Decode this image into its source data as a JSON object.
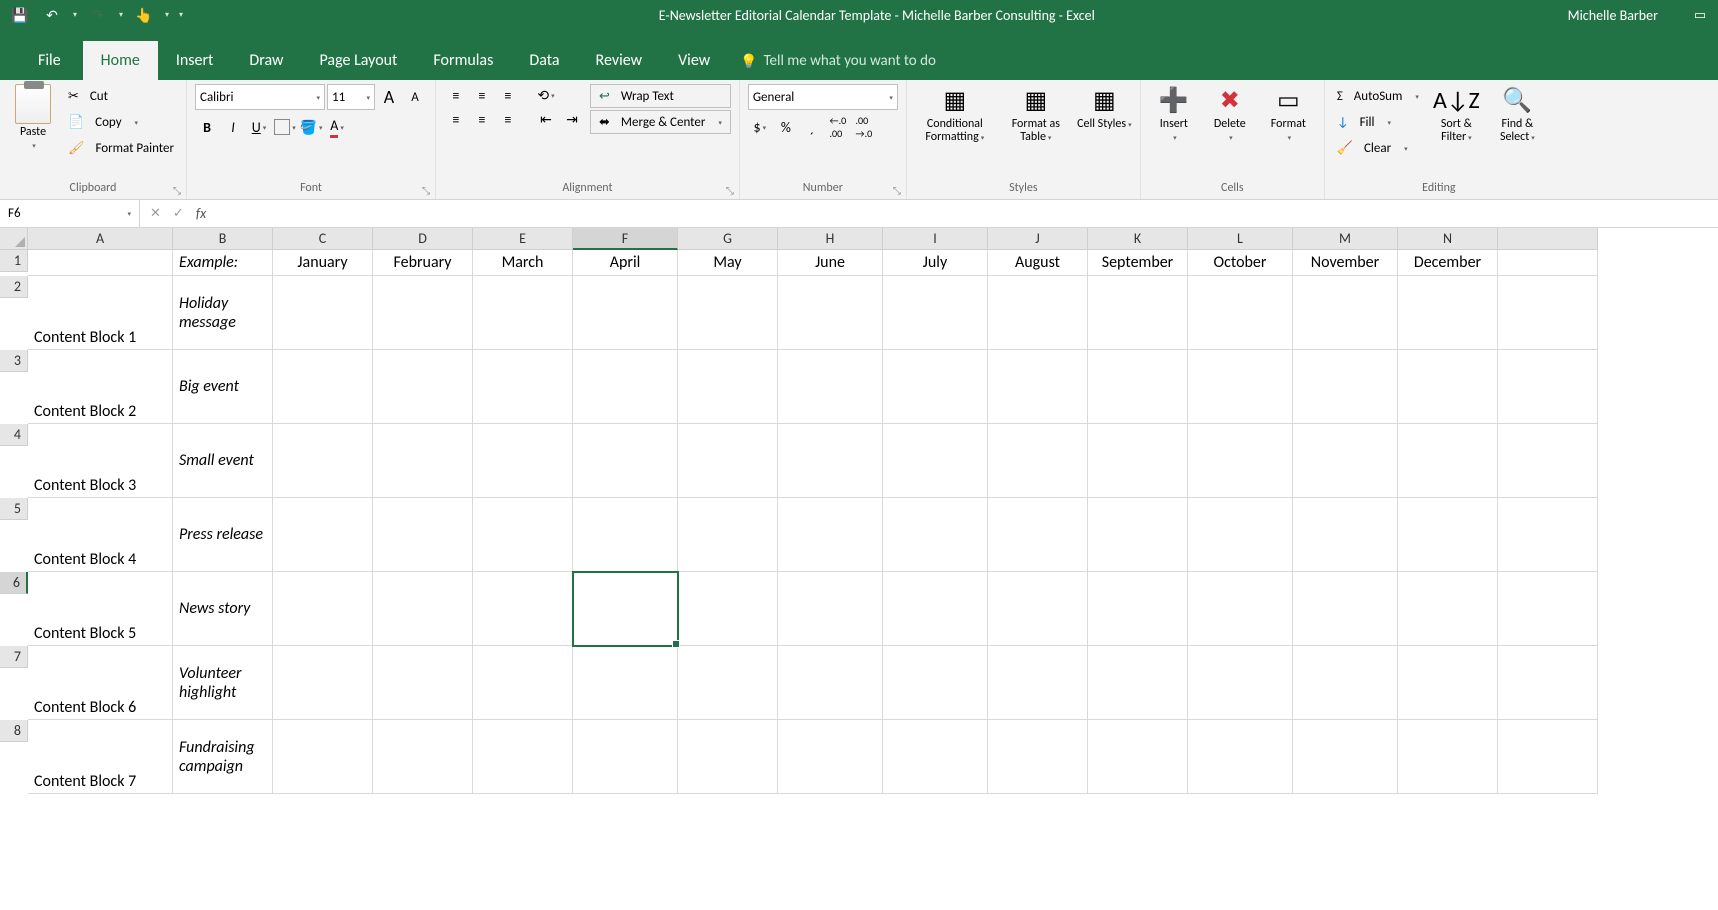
{
  "titlebar": {
    "title": "E-Newsletter Editorial Calendar Template - Michelle Barber Consulting - Excel",
    "user": "Michelle Barber"
  },
  "tabs": {
    "file": "File",
    "items": [
      "Home",
      "Insert",
      "Draw",
      "Page Layout",
      "Formulas",
      "Data",
      "Review",
      "View"
    ],
    "active": "Home",
    "tellme": "Tell me what you want to do"
  },
  "ribbon": {
    "clipboard": {
      "paste": "Paste",
      "cut": "Cut",
      "copy": "Copy",
      "format_painter": "Format Painter",
      "label": "Clipboard"
    },
    "font": {
      "name": "Calibri",
      "size": "11",
      "grow": "A",
      "shrink": "A",
      "bold": "B",
      "italic": "I",
      "underline": "U",
      "label": "Font"
    },
    "alignment": {
      "wrap": "Wrap Text",
      "merge": "Merge & Center",
      "label": "Alignment"
    },
    "number": {
      "format": "General",
      "label": "Number"
    },
    "styles": {
      "conditional": "Conditional Formatting",
      "format_as": "Format as Table",
      "cell_styles": "Cell Styles",
      "label": "Styles"
    },
    "cells": {
      "insert": "Insert",
      "delete": "Delete",
      "format": "Format",
      "label": "Cells"
    },
    "editing": {
      "autosum": "AutoSum",
      "fill": "Fill",
      "clear": "Clear",
      "sort": "Sort & Filter",
      "find": "Find & Select",
      "label": "Editing"
    }
  },
  "namebox": "F6",
  "grid": {
    "columns": [
      "A",
      "B",
      "C",
      "D",
      "E",
      "F",
      "G",
      "H",
      "I",
      "J",
      "K",
      "L",
      "M",
      "N"
    ],
    "header_row": {
      "A": "",
      "B": "Example:",
      "months": [
        "January",
        "February",
        "March",
        "April",
        "May",
        "June",
        "July",
        "August",
        "September",
        "October",
        "November",
        "December"
      ]
    },
    "rows": [
      {
        "num": 2,
        "label": "Content Block 1",
        "example": "Holiday message"
      },
      {
        "num": 3,
        "label": "Content Block 2",
        "example": "Big event"
      },
      {
        "num": 4,
        "label": "Content Block 3",
        "example": "Small event"
      },
      {
        "num": 5,
        "label": "Content Block 4",
        "example": "Press release"
      },
      {
        "num": 6,
        "label": "Content Block 5",
        "example": "News story"
      },
      {
        "num": 7,
        "label": "Content Block 6",
        "example": "Volunteer highlight"
      },
      {
        "num": 8,
        "label": "Content Block 7",
        "example": "Fundraising campaign"
      }
    ],
    "selected_cell": "F6",
    "selected_col": "F",
    "selected_row": 6
  }
}
